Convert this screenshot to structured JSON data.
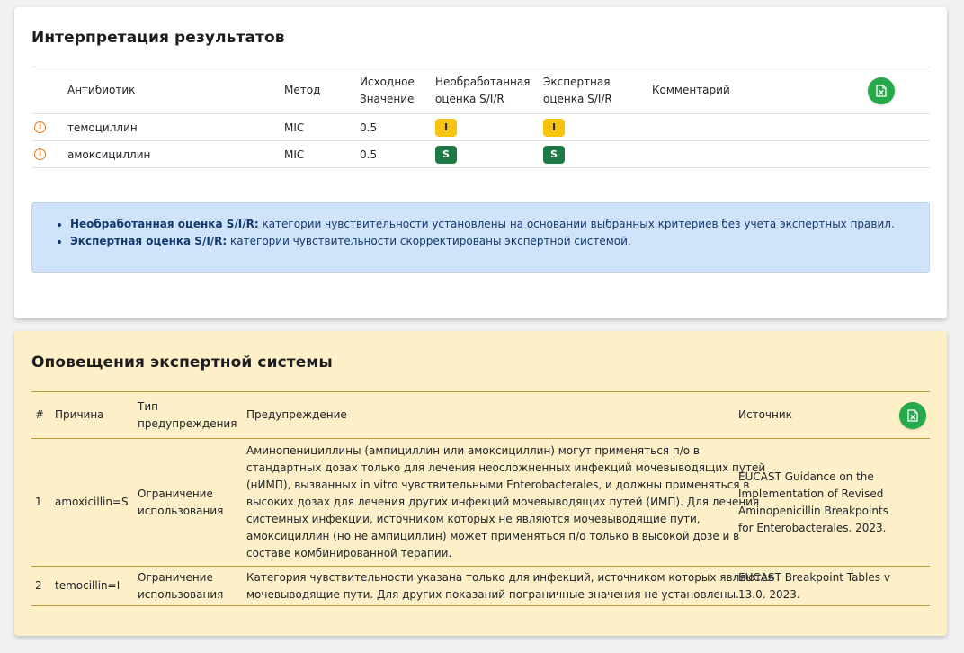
{
  "results": {
    "title": "Интерпретация результатов",
    "headers": {
      "antibiotic": "Антибиотик",
      "method": "Метод",
      "initial_value_l1": "Исходное",
      "initial_value_l2": "Значение",
      "raw_l1": "Необработанная",
      "raw_l2": "оценка S/I/R",
      "expert_l1": "Экспертная",
      "expert_l2": "оценка S/I/R",
      "comment": "Комментарий"
    },
    "export_icon": "excel-export-icon",
    "rows": [
      {
        "antibiotic": "темоциллин",
        "method": "MIC",
        "value": "0.5",
        "raw": "I",
        "expert": "I",
        "comment": ""
      },
      {
        "antibiotic": "амоксициллин",
        "method": "MIC",
        "value": "0.5",
        "raw": "S",
        "expert": "S",
        "comment": ""
      }
    ],
    "legend": {
      "raw_term": "Необработанная оценка S/I/R:",
      "raw_text": " категории чувствительности установлены на основании выбранных критериев без учета экспертных правил.",
      "expert_term": "Экспертная оценка S/I/R:",
      "expert_text": " категории чувствительности скорректированы экспертной системой."
    }
  },
  "warnings": {
    "title": "Оповещения экспертной системы",
    "headers": {
      "num": "#",
      "reason": "Причина",
      "type_l1": "Тип",
      "type_l2": "предупреждения",
      "warning": "Предупреждение",
      "source": "Источник"
    },
    "rows": [
      {
        "num": "1",
        "reason": "amoxicillin=S",
        "type_l1": "Ограничение",
        "type_l2": "использования",
        "warning_lines": [
          "Аминопенициллины (ампициллин или амоксициллин) могут применяться п/о в",
          "стандартных дозах только для лечения неосложненных инфекций мочевыводящих путей",
          "(нИМП), вызванных in vitro чувствительными Enterobacterales, и должны применяться в",
          "высоких дозах для лечения других инфекций мочевыводящих путей (ИМП). Для лечения",
          "системных инфекции, источником которых не являются мочевыводящие пути,",
          "амоксициллин (но не ампициллин) может применяться п/о только в высокой дозе и в",
          "составе комбинированной терапии."
        ],
        "source_lines": [
          "EUCAST Guidance on the",
          "Implementation of Revised",
          "Aminopenicillin Breakpoints",
          "for Enterobacterales. 2023."
        ]
      },
      {
        "num": "2",
        "reason": "temocillin=I",
        "type_l1": "Ограничение",
        "type_l2": "использования",
        "warning_lines": [
          "Категория чувствительности указана только для инфекций, источником которых являются",
          "мочевыводящие пути. Для других показаний пограничные значения не установлены."
        ],
        "source_lines": [
          "EUCAST Breakpoint Tables v",
          "13.0. 2023."
        ]
      }
    ]
  },
  "colors": {
    "badge_I": "#f7c210",
    "badge_S": "#1e7a44",
    "excel_button": "#26a94a",
    "warning_card_bg": "#fdf0c8",
    "legend_bg": "#cfe3fb",
    "info_icon": "#e07a1c"
  }
}
